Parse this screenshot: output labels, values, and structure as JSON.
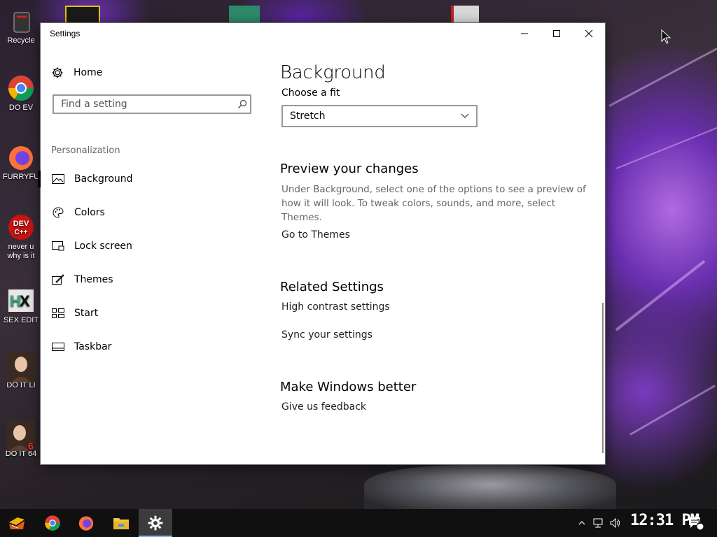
{
  "desktop": {
    "icons": [
      {
        "label": "Recycle",
        "name": "recycle-bin"
      },
      {
        "label": "DO EV",
        "name": "chrome"
      },
      {
        "label": "FURRYFU",
        "name": "firefox"
      },
      {
        "label": "never u",
        "label2": "why is it",
        "name": "dev-cpp"
      },
      {
        "label": "SEX EDIT",
        "name": "hx-editor"
      },
      {
        "label": "DO IT LI",
        "name": "portrait-1"
      },
      {
        "label": "DO IT 64",
        "name": "portrait-2"
      }
    ]
  },
  "window": {
    "title": "Settings",
    "controls": {
      "minimize": "minimize",
      "maximize": "maximize",
      "close": "close"
    }
  },
  "nav": {
    "home_label": "Home",
    "search_placeholder": "Find a setting",
    "section_label": "Personalization",
    "items": [
      {
        "label": "Background",
        "icon": "picture-icon",
        "selected": true
      },
      {
        "label": "Colors",
        "icon": "palette-icon",
        "selected": false
      },
      {
        "label": "Lock screen",
        "icon": "lock-screen-icon",
        "selected": false
      },
      {
        "label": "Themes",
        "icon": "themes-icon",
        "selected": false
      },
      {
        "label": "Start",
        "icon": "start-icon",
        "selected": false
      },
      {
        "label": "Taskbar",
        "icon": "taskbar-icon",
        "selected": false
      }
    ]
  },
  "content": {
    "title": "Background",
    "fit_label": "Choose a fit",
    "fit_value": "Stretch",
    "preview_heading": "Preview your changes",
    "preview_desc": "Under Background, select one of the options to see a preview of how it will look. To tweak colors, sounds, and more, select Themes.",
    "themes_link": "Go to Themes",
    "related_heading": "Related Settings",
    "related_links": [
      "High contrast settings",
      "Sync your settings"
    ],
    "better_heading": "Make Windows better",
    "feedback_link": "Give us feedback"
  },
  "taskbar": {
    "apps": [
      "start",
      "chrome",
      "firefox",
      "file-explorer",
      "settings"
    ],
    "clock": "12:31 PM",
    "notification_count": "1"
  },
  "colors": {
    "accent_selected": "#000000",
    "window_bg": "#ffffff",
    "taskbar_bg": "#101010"
  }
}
